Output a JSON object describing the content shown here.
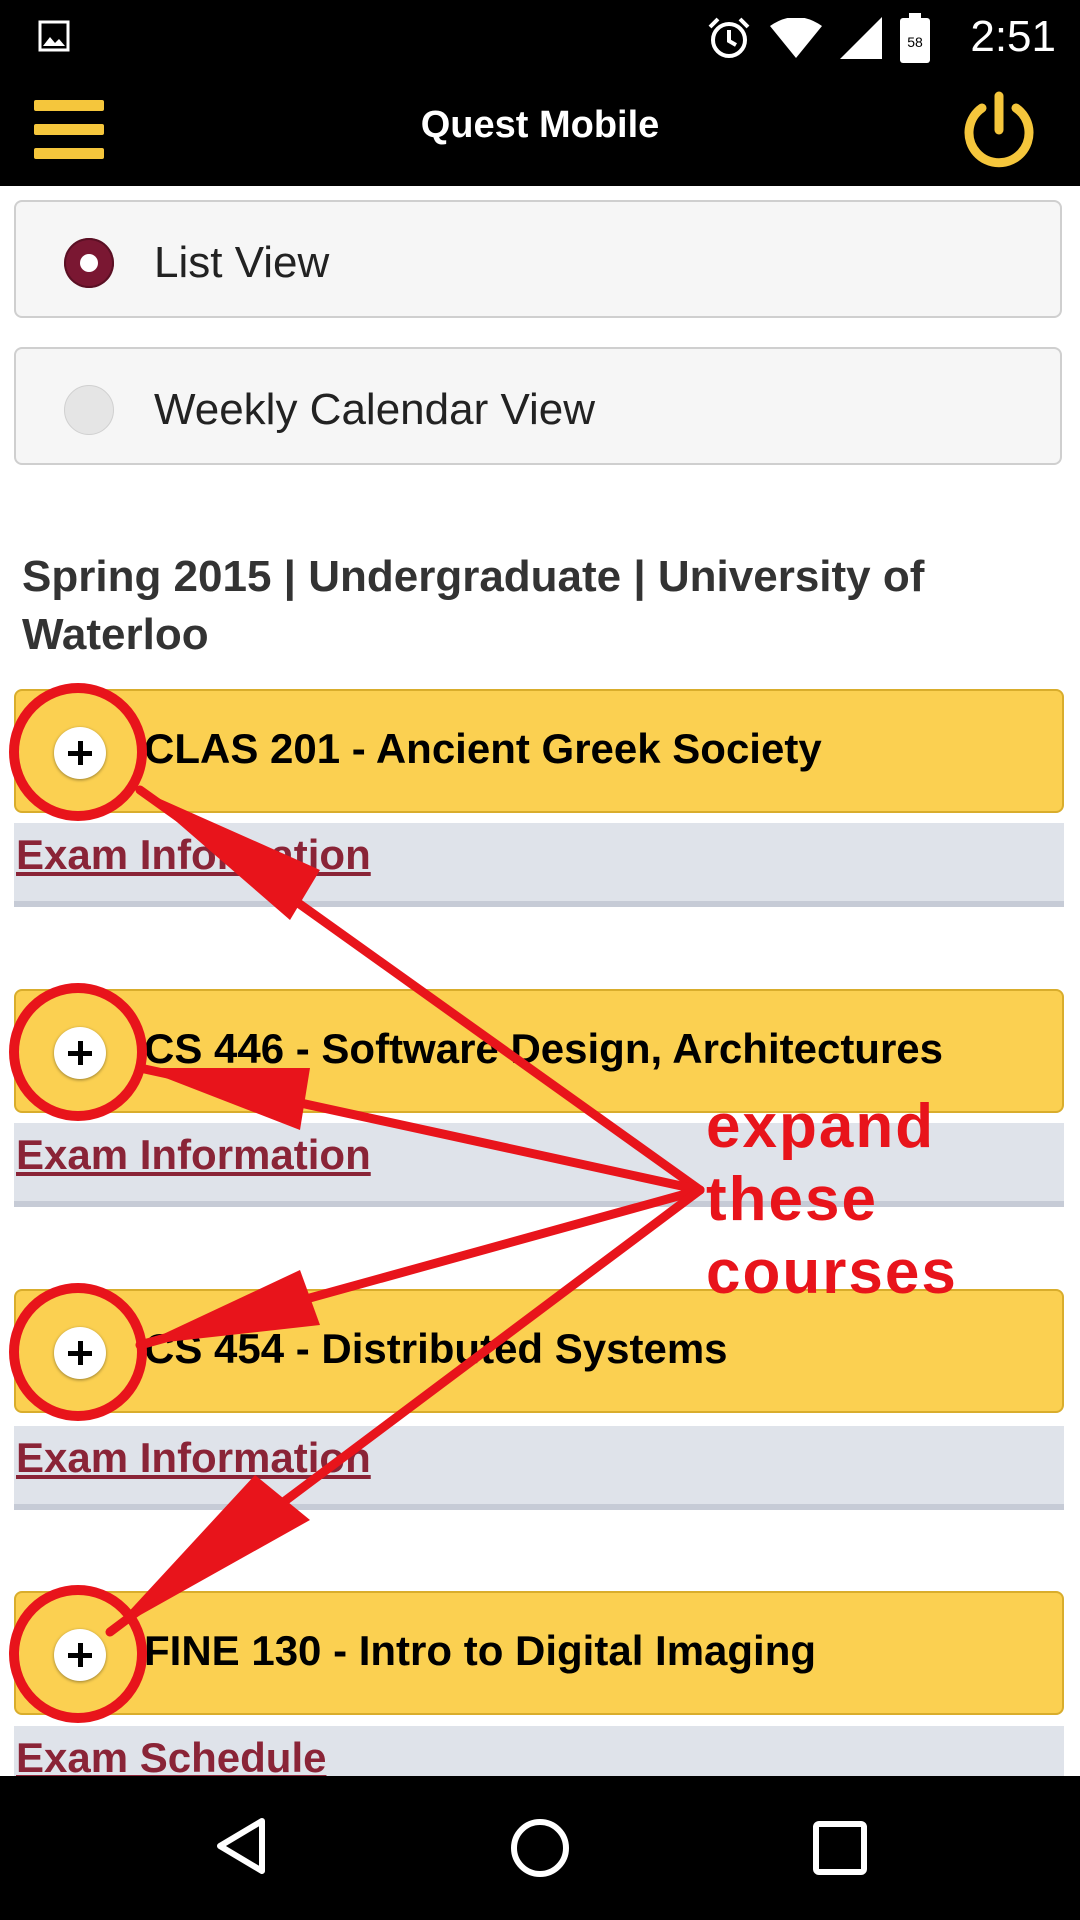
{
  "status_bar": {
    "time": "2:51",
    "battery": "58"
  },
  "app_bar": {
    "title": "Quest Mobile"
  },
  "view_options": [
    {
      "label": "List View",
      "selected": true
    },
    {
      "label": "Weekly Calendar View",
      "selected": false
    }
  ],
  "term_header": "Spring 2015 | Undergraduate | University of Waterloo",
  "courses": [
    {
      "title": "CLAS 201 - Ancient Greek Society",
      "link": "Exam Information"
    },
    {
      "title": "CS 446 - Software Design, Architectures",
      "link": "Exam Information"
    },
    {
      "title": "CS 454 - Distributed Systems",
      "link": "Exam Information"
    },
    {
      "title": "FINE 130 - Intro to Digital Imaging",
      "link": "Exam Schedule"
    }
  ],
  "annotation": {
    "lines": [
      "expand",
      "these",
      "courses"
    ],
    "color": "#e8141b"
  },
  "colors": {
    "accent_yellow": "#fbd051",
    "maroon": "#7a1732",
    "link": "#8a2437"
  }
}
